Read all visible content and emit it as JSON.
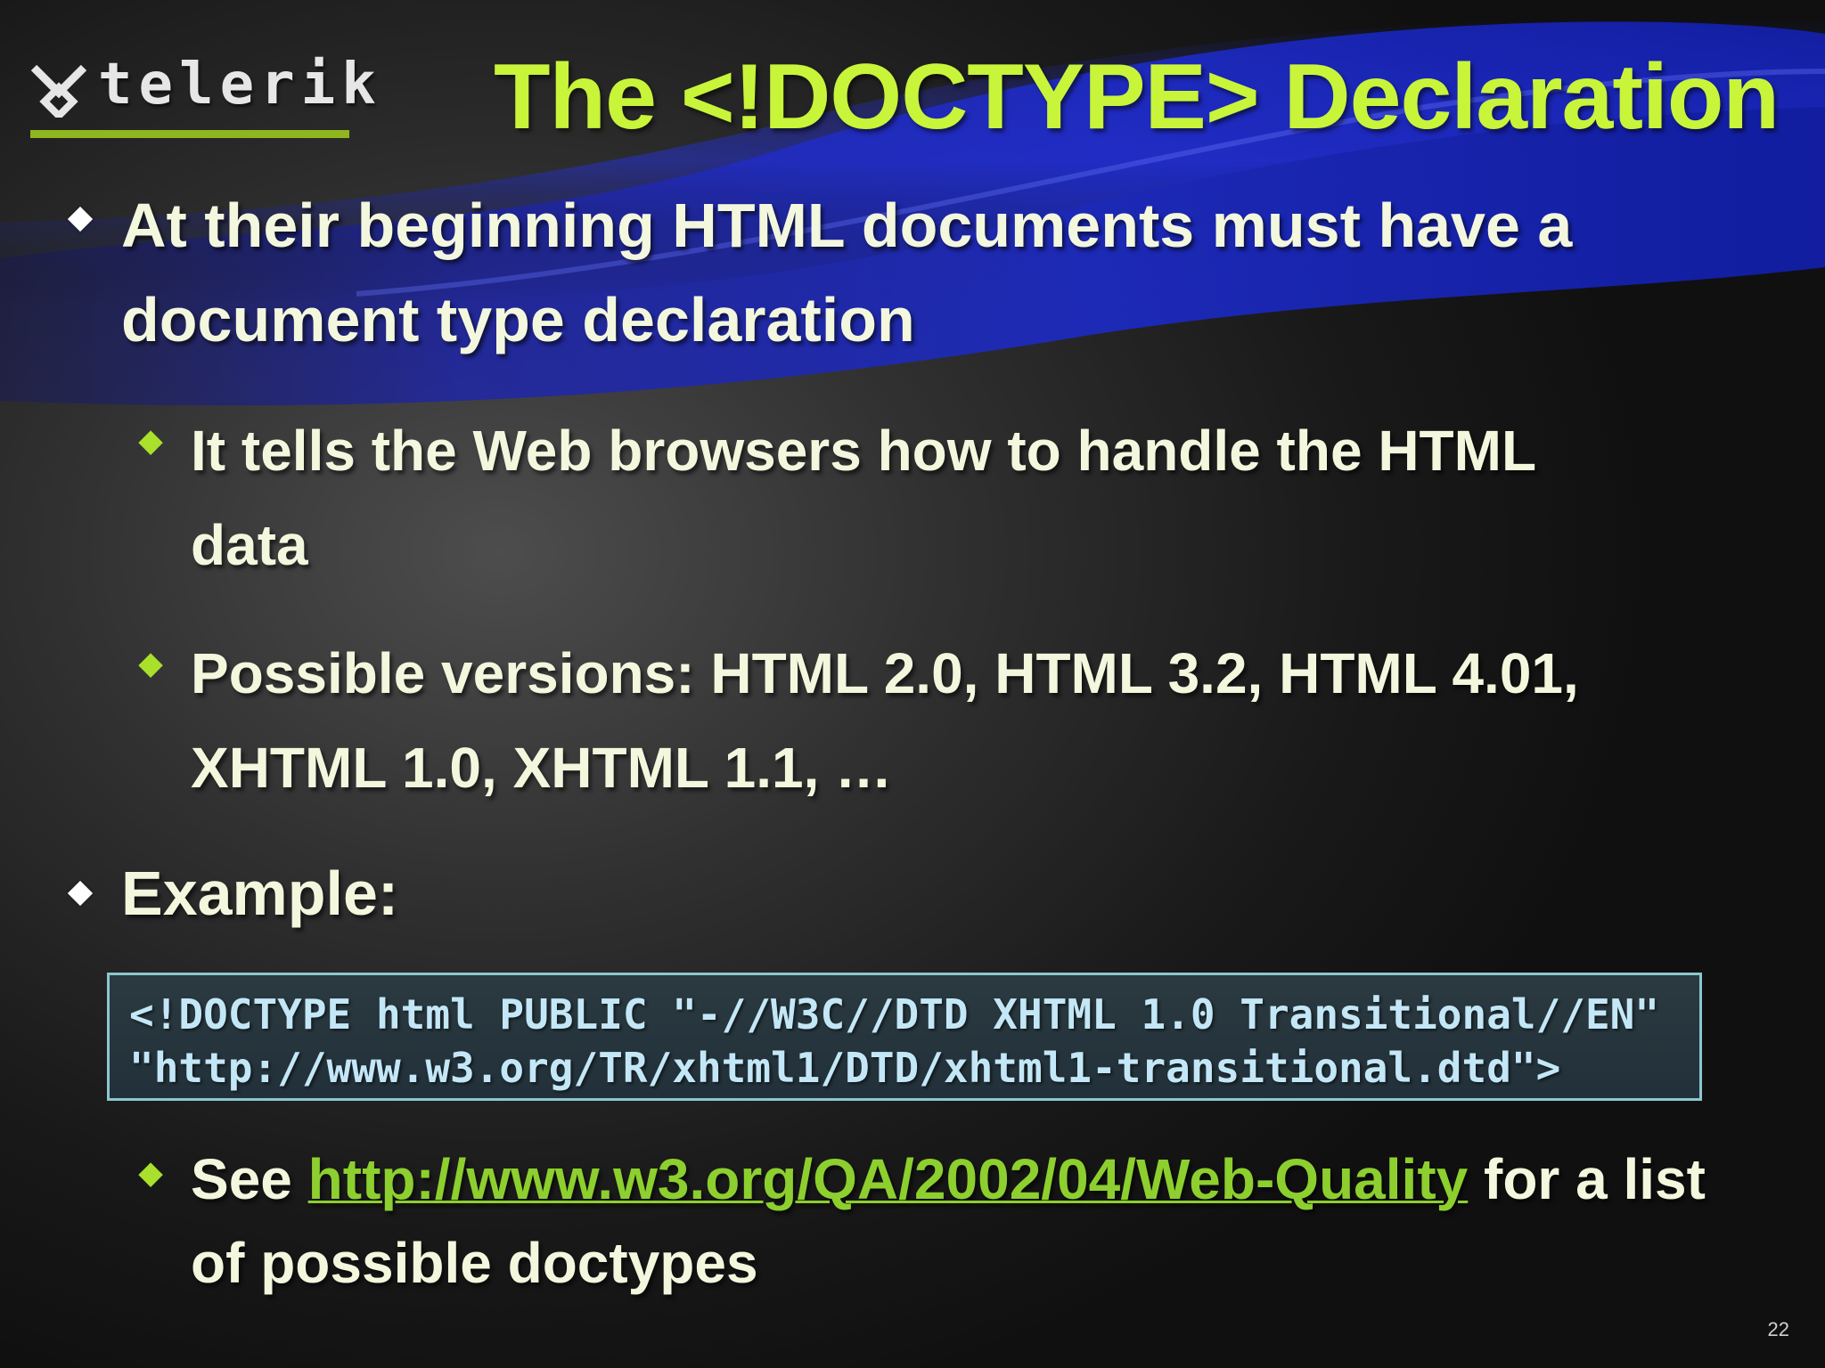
{
  "header": {
    "logo_text": "telerik",
    "title": "The <!DOCTYPE> Declaration"
  },
  "content": {
    "bullet1": {
      "line1": "At their beginning HTML documents must have a",
      "line2": "document type declaration"
    },
    "sub1": {
      "line1": "It tells the Web browsers how to handle the HTML",
      "line2": "data"
    },
    "sub2": {
      "line1": "Possible versions: HTML 2.0, HTML 3.2, HTML 4.01,",
      "line2": "XHTML 1.0, XHTML 1.1, …"
    },
    "bullet2": {
      "label": "Example:"
    },
    "code": {
      "line1": "<!DOCTYPE html PUBLIC \"-//W3C//DTD XHTML 1.0 Transitional//EN\"",
      "line2": "\"http://www.w3.org/TR/xhtml1/DTD/xhtml1-transitional.dtd\">"
    },
    "sub3": {
      "before": "See ",
      "link": "http://www.w3.org/QA/2002/04/Web-Quality",
      "after": " for a list",
      "line2": "of possible doctypes"
    }
  },
  "footer": {
    "page_number": "22"
  },
  "colors": {
    "title": "#c8f43a",
    "text": "#f3f7dd",
    "link": "#8dcf2e",
    "accent_blue": "#1a23b8",
    "code_text": "#c3e7f7",
    "code_border": "#8cc7cf"
  }
}
